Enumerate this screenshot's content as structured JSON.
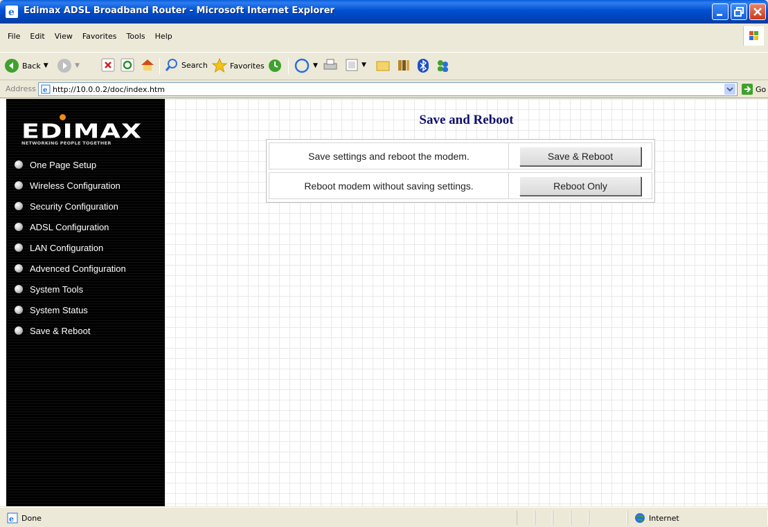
{
  "window": {
    "title": "Edimax ADSL Broadband Router - Microsoft Internet Explorer"
  },
  "menubar": {
    "items": [
      "File",
      "Edit",
      "View",
      "Favorites",
      "Tools",
      "Help"
    ]
  },
  "toolbar": {
    "back_label": "Back",
    "search_label": "Search",
    "favorites_label": "Favorites"
  },
  "address": {
    "label": "Address",
    "url": "http://10.0.0.2/doc/index.htm",
    "go_label": "Go"
  },
  "sidebar": {
    "logo": "EDIMAX",
    "tagline": "NETWORKING PEOPLE TOGETHER",
    "items": [
      {
        "label": "One Page Setup"
      },
      {
        "label": "Wireless Configuration"
      },
      {
        "label": "Security Configuration"
      },
      {
        "label": "ADSL Configuration"
      },
      {
        "label": "LAN Configuration"
      },
      {
        "label": "Advenced Configuration"
      },
      {
        "label": "System Tools"
      },
      {
        "label": "System Status"
      },
      {
        "label": "Save & Reboot"
      }
    ]
  },
  "main": {
    "title": "Save and Reboot",
    "rows": [
      {
        "description": "Save settings and reboot the modem.",
        "button": "Save & Reboot"
      },
      {
        "description": "Reboot modem without saving settings.",
        "button": "Reboot Only"
      }
    ]
  },
  "statusbar": {
    "status": "Done",
    "zone": "Internet"
  },
  "colors": {
    "titlebar": "#0050D0",
    "sidebar_bg": "#000000",
    "title_text": "#0F0F6E",
    "logo_dot": "#F28A1A"
  }
}
